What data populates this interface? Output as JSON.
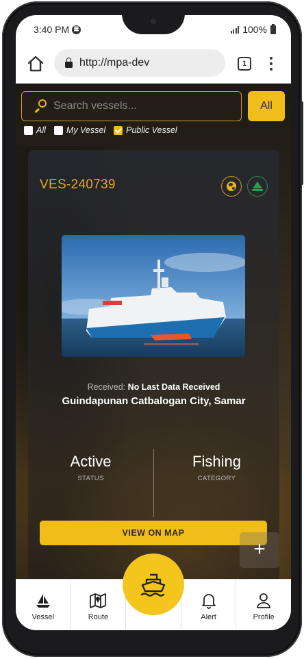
{
  "status_bar": {
    "time": "3:40 PM",
    "battery": "100%"
  },
  "browser": {
    "url": "http://mpa-dev",
    "tab_count": "1"
  },
  "search": {
    "placeholder": "Search vessels...",
    "filter_button": "All"
  },
  "filters": [
    {
      "label": "All",
      "checked": false
    },
    {
      "label": "My Vessel",
      "checked": false
    },
    {
      "label": "Public Vessel",
      "checked": true
    }
  ],
  "vessel": {
    "id": "VES-240739",
    "received_label": "Received:",
    "received_value": "No Last Data Received",
    "location": "Guindapunan Catbalogan City, Samar",
    "status_value": "Active",
    "status_label": "STATUS",
    "category_value": "Fishing",
    "category_label": "CATEGORY",
    "map_button": "VIEW ON MAP"
  },
  "fab": {
    "plus": "+"
  },
  "nav": {
    "vessel": "Vessel",
    "route": "Route",
    "alert": "Alert",
    "profile": "Profile"
  },
  "colors": {
    "accent": "#f0bd1a",
    "vessel_id": "#e9a915",
    "green": "#2f9a52"
  },
  "icons": [
    "home-icon",
    "lock-icon",
    "search-icon",
    "globe-icon",
    "sailboat-icon",
    "map-icon",
    "ship-icon",
    "bell-icon",
    "person-icon",
    "plus-icon"
  ]
}
